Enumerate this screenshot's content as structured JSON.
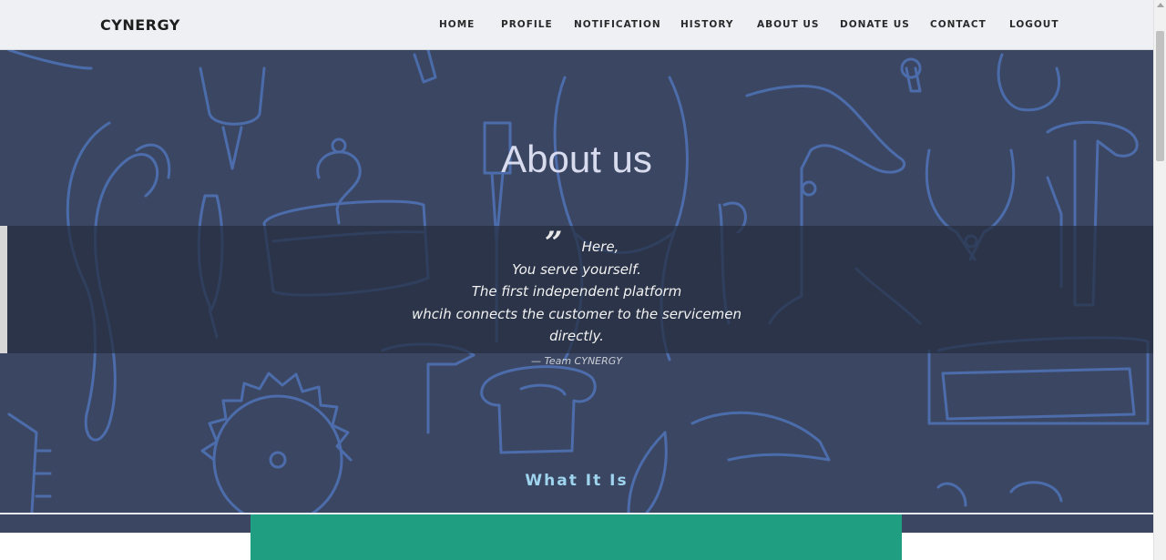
{
  "navbar": {
    "brand": "CYNERGY",
    "links": [
      {
        "id": "home",
        "label": "HOME"
      },
      {
        "id": "profile",
        "label": "PROFILE"
      },
      {
        "id": "notification",
        "label": "NOTIFICATION"
      },
      {
        "id": "history",
        "label": "HISTORY"
      },
      {
        "id": "about-us",
        "label": "ABOUT US"
      },
      {
        "id": "donate-us",
        "label": "DONATE US"
      },
      {
        "id": "contact",
        "label": "CONTACT"
      },
      {
        "id": "logout",
        "label": "LOGOUT"
      }
    ]
  },
  "hero": {
    "title": "About us",
    "quote_mark": "”",
    "quote_lines": [
      "Here,",
      "You serve yourself.",
      "The first independent platform",
      "whcih connects the customer to the servicemen",
      "directly."
    ],
    "attribution": "— Team CYNERGY",
    "section_heading": "What It Is",
    "background_pattern": "tool-doodle-pattern"
  },
  "colors": {
    "navbar_bg": "#eef0f3",
    "hero_bg": "#3b4762",
    "doodle_stroke": "#4f73b8",
    "quote_band": "#262e3e",
    "heading_accent": "#9fd4ef",
    "card_teal": "#1f9e82"
  }
}
